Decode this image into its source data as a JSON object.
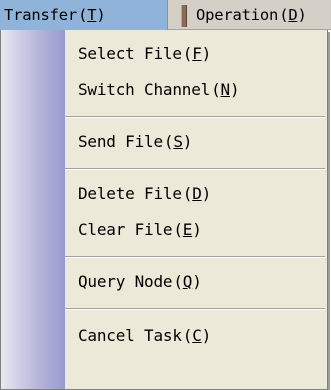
{
  "menubar": {
    "transfer": {
      "label": "Transfer",
      "accel": "T"
    },
    "operation": {
      "label": "Operation",
      "accel": "D"
    }
  },
  "transfer_menu": {
    "items": [
      {
        "label": "Select File",
        "accel": "F"
      },
      {
        "label": "Switch Channel",
        "accel": "N"
      },
      {
        "label": "Send File",
        "accel": "S"
      },
      {
        "label": "Delete File",
        "accel": "D"
      },
      {
        "label": "Clear File",
        "accel": "E"
      },
      {
        "label": "Query Node",
        "accel": "Q"
      },
      {
        "label": "Cancel Task",
        "accel": "C"
      }
    ]
  },
  "colors": {
    "menubar_bg": "#d4d0c8",
    "active_menu_bg": "#8fb3d9",
    "dropdown_bg": "#ece9d8",
    "gutter": "#9a9ad2"
  }
}
